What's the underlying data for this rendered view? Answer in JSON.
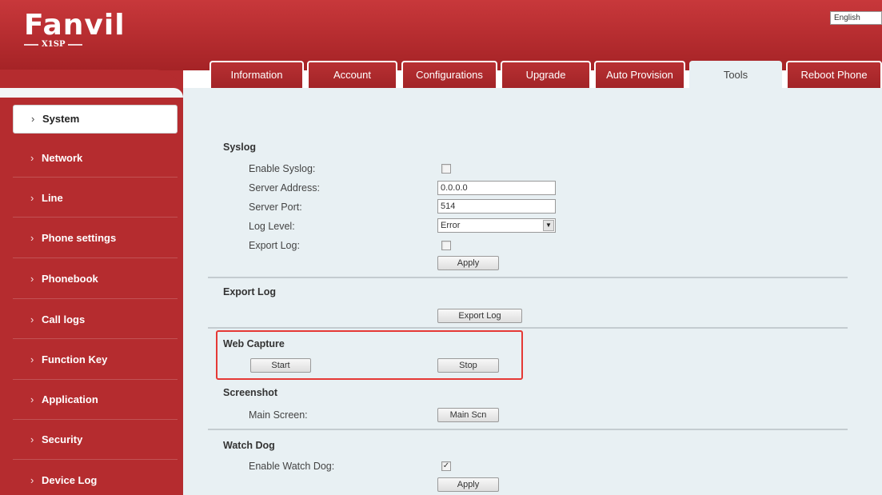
{
  "header": {
    "logo_text": "Fanvil",
    "model": "X1SP",
    "language": "English",
    "colors": {
      "brand_red": "#b52c2f",
      "content_bg": "#e8f0f3",
      "highlight": "#e53935"
    }
  },
  "tabs": [
    {
      "label": "Information",
      "active": false
    },
    {
      "label": "Account",
      "active": false
    },
    {
      "label": "Configurations",
      "active": false
    },
    {
      "label": "Upgrade",
      "active": false
    },
    {
      "label": "Auto Provision",
      "active": false
    },
    {
      "label": "Tools",
      "active": true
    },
    {
      "label": "Reboot Phone",
      "active": false
    }
  ],
  "sidebar": {
    "items": [
      {
        "label": "System",
        "active": true
      },
      {
        "label": "Network"
      },
      {
        "label": "Line"
      },
      {
        "label": "Phone settings"
      },
      {
        "label": "Phonebook"
      },
      {
        "label": "Call logs"
      },
      {
        "label": "Function Key"
      },
      {
        "label": "Application"
      },
      {
        "label": "Security"
      },
      {
        "label": "Device Log"
      }
    ],
    "arrow": "›"
  },
  "syslog": {
    "title": "Syslog",
    "enable_label": "Enable Syslog:",
    "enable_checked": false,
    "server_address_label": "Server Address:",
    "server_address_value": "0.0.0.0",
    "server_port_label": "Server Port:",
    "server_port_value": "514",
    "log_level_label": "Log Level:",
    "log_level_value": "Error",
    "export_log_label": "Export Log:",
    "export_log_checked": false,
    "apply_label": "Apply"
  },
  "export_log": {
    "title": "Export Log",
    "button_label": "Export Log"
  },
  "web_capture": {
    "title": "Web Capture",
    "start_label": "Start",
    "stop_label": "Stop"
  },
  "screenshot": {
    "title": "Screenshot",
    "main_screen_label": "Main Screen:",
    "button_label": "Main Scn"
  },
  "watchdog": {
    "title": "Watch Dog",
    "enable_label": "Enable Watch Dog:",
    "enable_checked": true,
    "check_mark": "✓",
    "apply_label": "Apply"
  }
}
